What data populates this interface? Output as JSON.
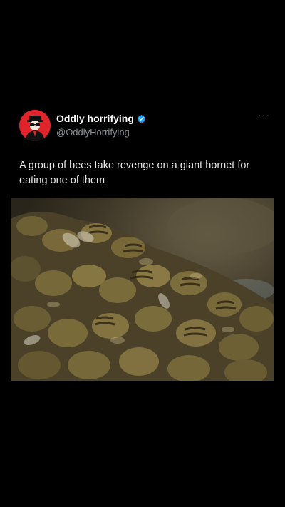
{
  "tweet": {
    "display_name": "Oddly horrifying",
    "handle": "@OddlyHorrifying",
    "verified": true,
    "text": "A group of bees take revenge on a giant hornet for eating one of them",
    "more_icon": "more-dots-icon",
    "verified_icon": "verified-badge-icon",
    "avatar_color": "#e0242b"
  },
  "colors": {
    "background": "#000000",
    "text": "#e8e8e8",
    "handle": "#8b8f94",
    "verified_blue": "#1d9bf0"
  }
}
